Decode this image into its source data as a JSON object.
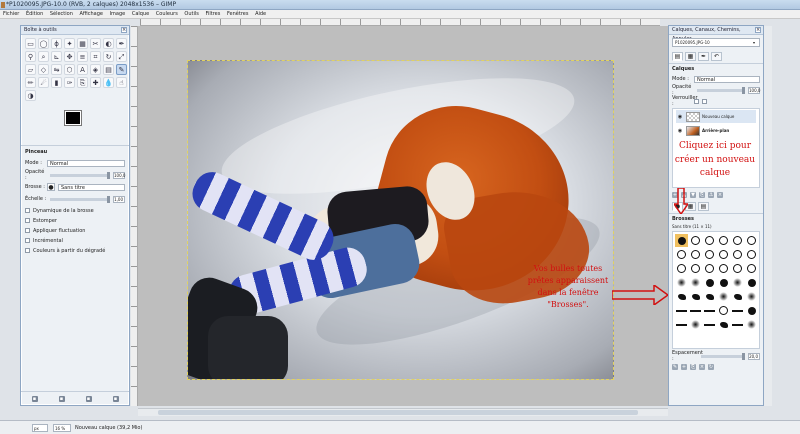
{
  "window": {
    "title": "*P1020095.JPG-10.0 (RVB, 2 calques) 2048x1536 – GIMP"
  },
  "menu": [
    "Fichier",
    "Édition",
    "Sélection",
    "Affichage",
    "Image",
    "Calque",
    "Couleurs",
    "Outils",
    "Filtres",
    "Fenêtres",
    "Aide"
  ],
  "toolbox": {
    "title": "Boîte à outils",
    "options_title": "Pinceau",
    "mode_label": "Mode :",
    "mode_value": "Normal",
    "opacity_label": "Opacité :",
    "opacity_value": "100,0",
    "brush_label": "Brosse :",
    "brush_value": "Sans titre",
    "scale_label": "Échelle :",
    "scale_value": "1,00",
    "checks": [
      "Dynamique de la brosse",
      "Estomper",
      "Appliquer fluctuation",
      "Incrémental",
      "Couleurs à partir du dégradé"
    ]
  },
  "layers_dock": {
    "title": "Calques, Canaux, Chemins, Annuler...",
    "image_select": "P1020095.JPG-10",
    "section_title": "Calques",
    "mode_label": "Mode :",
    "mode_value": "Normal",
    "opacity_label": "Opacité :",
    "opacity_value": "100,0",
    "lock_label": "Verrouiller :",
    "layers": [
      {
        "name": "Nouveau calque"
      },
      {
        "name": "Arrière-plan"
      }
    ],
    "brushes_title": "Brosses",
    "brush_info": "Sans titre (11 × 11)",
    "spacing_label": "Espacement :",
    "spacing_value": "20,0"
  },
  "annotations": {
    "new_layer": "Cliquez ici pour créer un nouveau calque",
    "brushes": "Vos bulles toutes prêtes apparaissent dans la fenêtre \"Brosses\"."
  },
  "status": {
    "units": "px",
    "zoom": "16 %",
    "info": "Nouveau calque (39,2 Mio)"
  },
  "colors": {
    "annotation": "#d21010",
    "foreground": "#000000",
    "background": "#ffffff"
  }
}
